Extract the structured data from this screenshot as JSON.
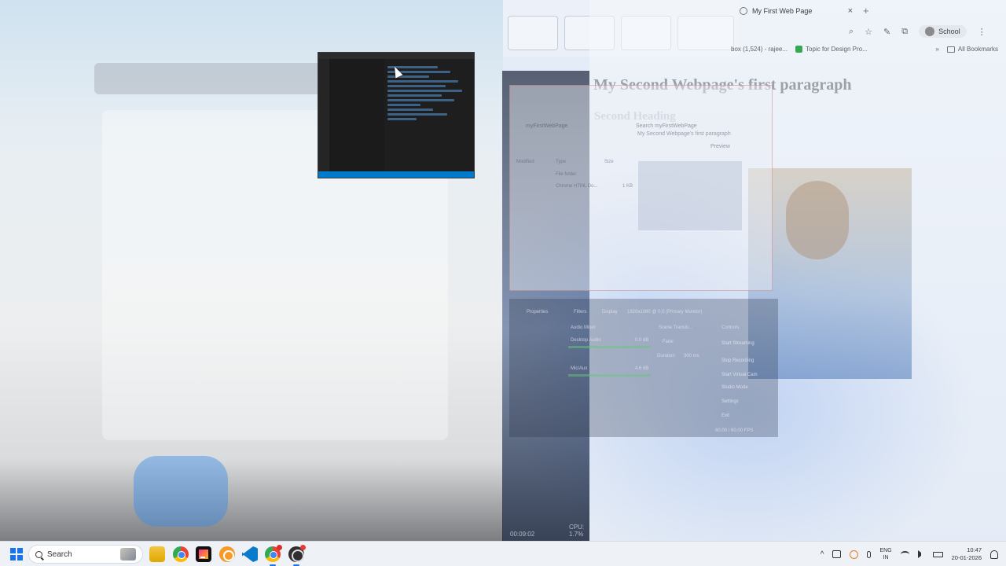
{
  "chrome": {
    "tab_title": "My First Web Page",
    "tab_close": "×",
    "new_tab": "+",
    "profile": "School",
    "bookmarks": [
      {
        "label": "box (1,524) - rajee..."
      },
      {
        "label": "Topic for Design Pro..."
      }
    ],
    "bookmarks_more": "»",
    "all_bookmarks": "All Bookmarks"
  },
  "page": {
    "heading": "My Second Webpage's first paragraph",
    "subheading": "Second Heading"
  },
  "file_dialog": {
    "breadcrumb": "myFirstWebPage",
    "search": "Search myFirstWebPage",
    "paragraph": "My Second Webpage's first paragraph",
    "preview": "Preview",
    "col_modified": "Modified",
    "col_type": "Type",
    "col_size": "Size",
    "row1_type": "File folder",
    "row2_type": "Chrome HTML Do...",
    "row2_size": "1 KB"
  },
  "obs": {
    "tabs": [
      "Properties",
      "Filters",
      "Display"
    ],
    "display": "1920x1080 @ 0,0 (Primary Monitor)",
    "audio_mixer": "Audio Mixer",
    "scene_transitions": "Scene Transiti...",
    "controls": "Controls",
    "desktop_audio": "Desktop Audio",
    "mic_aux": "Mic/Aux",
    "db1": "0.0 dB",
    "db2": "4.6 dB",
    "fade": "Fade",
    "duration_label": "Duration",
    "duration": "300 ms",
    "start_streaming": "Start Streaming",
    "stop_recording": "Stop Recording",
    "virtual_camera": "Start Virtual Cam",
    "studio_mode": "Studio Mode",
    "settings": "Settings",
    "exit": "Exit",
    "rec_time": "00:09:02",
    "cpu": "CPU: 1.7%",
    "fps": "60.00 / 60.00 FPS"
  },
  "taskbar": {
    "search_placeholder": "Search",
    "language": "ENG",
    "region": "IN",
    "time": "10:47",
    "date": "20-01-2026",
    "tray_chevron": "^"
  }
}
